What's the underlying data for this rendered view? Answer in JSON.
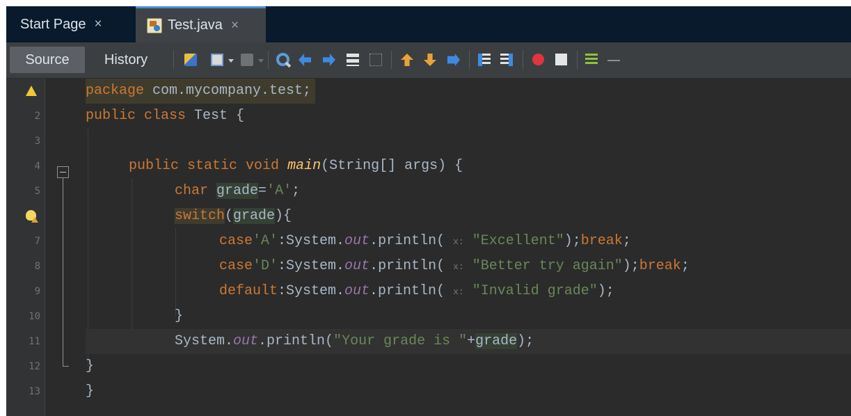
{
  "tabs": [
    {
      "label": "Start Page",
      "close": "×"
    },
    {
      "label": "Test.java",
      "close": "×"
    }
  ],
  "toolbar": {
    "source_label": "Source",
    "history_label": "History"
  },
  "editor": {
    "line_numbers": [
      "2",
      "3",
      "4",
      "5",
      "7",
      "8",
      "9",
      "10",
      "11",
      "12",
      "13"
    ],
    "code": {
      "l1_kw": "package",
      "l1_rest": " com.mycompany.test;",
      "l2_kw": "public class",
      "l2_rest": " Test {",
      "l4_kw": "public static void",
      "l4_fn": "main",
      "l4_rest": "(String[] args) {",
      "l5_kw": "char",
      "l5_var": "grade",
      "l5_eq": "=",
      "l5_str": "'A'",
      "l5_end": ";",
      "l6_kw": "switch",
      "l6_open": "(",
      "l6_var": "grade",
      "l6_close": "){",
      "l7_kw": "case",
      "l7_str": "'A'",
      "l7_mid": ":System.",
      "l7_fld": "out",
      "l7_call": ".println(",
      "l7_hint": "x:",
      "l7_arg": "\"Excellent\"",
      "l7_end": ");",
      "l7_brk": "break",
      "l7_semi": ";",
      "l8_kw": "case",
      "l8_str": "'D'",
      "l8_mid": ":System.",
      "l8_fld": "out",
      "l8_call": ".println(",
      "l8_hint": "x:",
      "l8_arg": "\"Better try again\"",
      "l8_end": ");",
      "l8_brk": "break",
      "l8_semi": ";",
      "l9_kw": "default",
      "l9_mid": ":System.",
      "l9_fld": "out",
      "l9_call": ".println(",
      "l9_hint": "x:",
      "l9_arg": "\"Invalid grade\"",
      "l9_end": ");",
      "l10": "}",
      "l11_pre": "System.",
      "l11_fld": "out",
      "l11_call": ".println(",
      "l11_arg": "\"Your grade is \"",
      "l11_plus": "+",
      "l11_var": "grade",
      "l11_end": ");",
      "l12": "}",
      "l13": "}"
    }
  }
}
